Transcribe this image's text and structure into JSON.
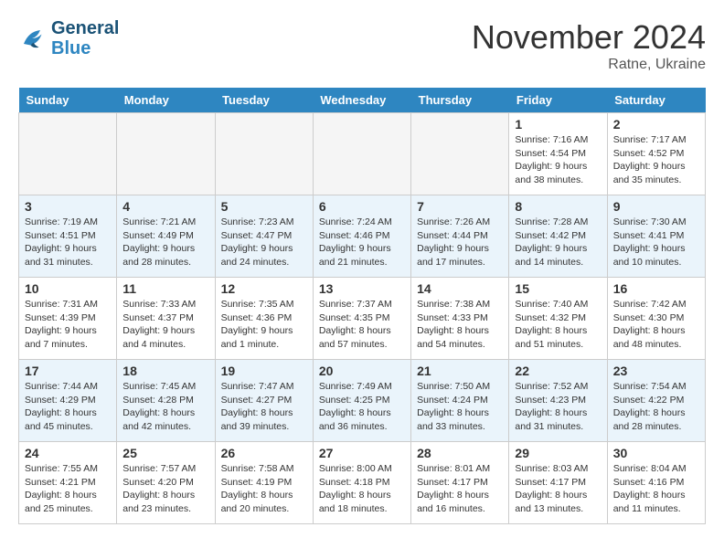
{
  "header": {
    "logo_line1": "General",
    "logo_line2": "Blue",
    "month_title": "November 2024",
    "location": "Ratne, Ukraine"
  },
  "days_of_week": [
    "Sunday",
    "Monday",
    "Tuesday",
    "Wednesday",
    "Thursday",
    "Friday",
    "Saturday"
  ],
  "weeks": [
    [
      {
        "day": "",
        "info": ""
      },
      {
        "day": "",
        "info": ""
      },
      {
        "day": "",
        "info": ""
      },
      {
        "day": "",
        "info": ""
      },
      {
        "day": "",
        "info": ""
      },
      {
        "day": "1",
        "info": "Sunrise: 7:16 AM\nSunset: 4:54 PM\nDaylight: 9 hours\nand 38 minutes."
      },
      {
        "day": "2",
        "info": "Sunrise: 7:17 AM\nSunset: 4:52 PM\nDaylight: 9 hours\nand 35 minutes."
      }
    ],
    [
      {
        "day": "3",
        "info": "Sunrise: 7:19 AM\nSunset: 4:51 PM\nDaylight: 9 hours\nand 31 minutes."
      },
      {
        "day": "4",
        "info": "Sunrise: 7:21 AM\nSunset: 4:49 PM\nDaylight: 9 hours\nand 28 minutes."
      },
      {
        "day": "5",
        "info": "Sunrise: 7:23 AM\nSunset: 4:47 PM\nDaylight: 9 hours\nand 24 minutes."
      },
      {
        "day": "6",
        "info": "Sunrise: 7:24 AM\nSunset: 4:46 PM\nDaylight: 9 hours\nand 21 minutes."
      },
      {
        "day": "7",
        "info": "Sunrise: 7:26 AM\nSunset: 4:44 PM\nDaylight: 9 hours\nand 17 minutes."
      },
      {
        "day": "8",
        "info": "Sunrise: 7:28 AM\nSunset: 4:42 PM\nDaylight: 9 hours\nand 14 minutes."
      },
      {
        "day": "9",
        "info": "Sunrise: 7:30 AM\nSunset: 4:41 PM\nDaylight: 9 hours\nand 10 minutes."
      }
    ],
    [
      {
        "day": "10",
        "info": "Sunrise: 7:31 AM\nSunset: 4:39 PM\nDaylight: 9 hours\nand 7 minutes."
      },
      {
        "day": "11",
        "info": "Sunrise: 7:33 AM\nSunset: 4:37 PM\nDaylight: 9 hours\nand 4 minutes."
      },
      {
        "day": "12",
        "info": "Sunrise: 7:35 AM\nSunset: 4:36 PM\nDaylight: 9 hours\nand 1 minute."
      },
      {
        "day": "13",
        "info": "Sunrise: 7:37 AM\nSunset: 4:35 PM\nDaylight: 8 hours\nand 57 minutes."
      },
      {
        "day": "14",
        "info": "Sunrise: 7:38 AM\nSunset: 4:33 PM\nDaylight: 8 hours\nand 54 minutes."
      },
      {
        "day": "15",
        "info": "Sunrise: 7:40 AM\nSunset: 4:32 PM\nDaylight: 8 hours\nand 51 minutes."
      },
      {
        "day": "16",
        "info": "Sunrise: 7:42 AM\nSunset: 4:30 PM\nDaylight: 8 hours\nand 48 minutes."
      }
    ],
    [
      {
        "day": "17",
        "info": "Sunrise: 7:44 AM\nSunset: 4:29 PM\nDaylight: 8 hours\nand 45 minutes."
      },
      {
        "day": "18",
        "info": "Sunrise: 7:45 AM\nSunset: 4:28 PM\nDaylight: 8 hours\nand 42 minutes."
      },
      {
        "day": "19",
        "info": "Sunrise: 7:47 AM\nSunset: 4:27 PM\nDaylight: 8 hours\nand 39 minutes."
      },
      {
        "day": "20",
        "info": "Sunrise: 7:49 AM\nSunset: 4:25 PM\nDaylight: 8 hours\nand 36 minutes."
      },
      {
        "day": "21",
        "info": "Sunrise: 7:50 AM\nSunset: 4:24 PM\nDaylight: 8 hours\nand 33 minutes."
      },
      {
        "day": "22",
        "info": "Sunrise: 7:52 AM\nSunset: 4:23 PM\nDaylight: 8 hours\nand 31 minutes."
      },
      {
        "day": "23",
        "info": "Sunrise: 7:54 AM\nSunset: 4:22 PM\nDaylight: 8 hours\nand 28 minutes."
      }
    ],
    [
      {
        "day": "24",
        "info": "Sunrise: 7:55 AM\nSunset: 4:21 PM\nDaylight: 8 hours\nand 25 minutes."
      },
      {
        "day": "25",
        "info": "Sunrise: 7:57 AM\nSunset: 4:20 PM\nDaylight: 8 hours\nand 23 minutes."
      },
      {
        "day": "26",
        "info": "Sunrise: 7:58 AM\nSunset: 4:19 PM\nDaylight: 8 hours\nand 20 minutes."
      },
      {
        "day": "27",
        "info": "Sunrise: 8:00 AM\nSunset: 4:18 PM\nDaylight: 8 hours\nand 18 minutes."
      },
      {
        "day": "28",
        "info": "Sunrise: 8:01 AM\nSunset: 4:17 PM\nDaylight: 8 hours\nand 16 minutes."
      },
      {
        "day": "29",
        "info": "Sunrise: 8:03 AM\nSunset: 4:17 PM\nDaylight: 8 hours\nand 13 minutes."
      },
      {
        "day": "30",
        "info": "Sunrise: 8:04 AM\nSunset: 4:16 PM\nDaylight: 8 hours\nand 11 minutes."
      }
    ]
  ]
}
